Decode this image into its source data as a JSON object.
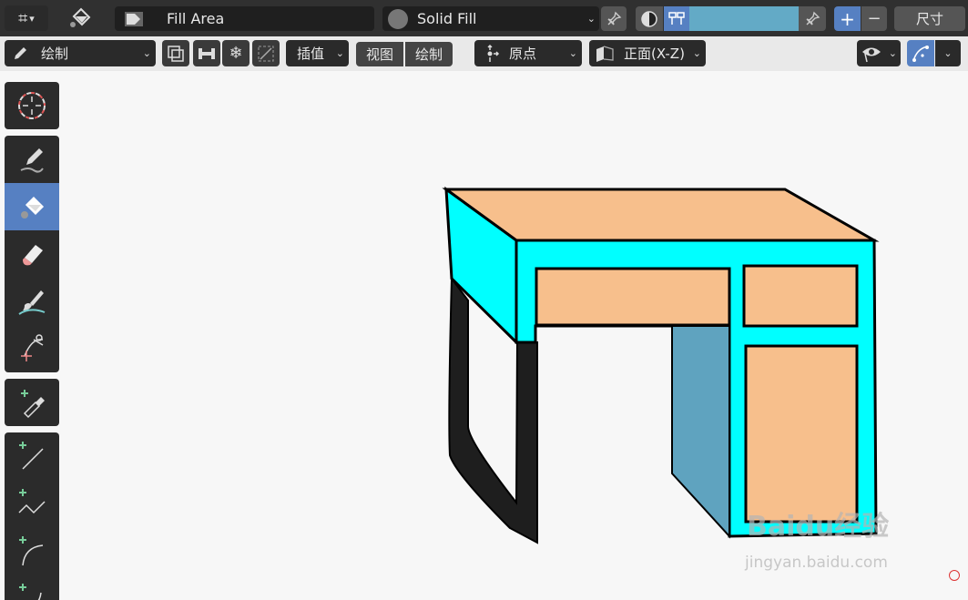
{
  "header": {
    "fill_mode": "Fill Area",
    "fill_type": "Solid Fill",
    "size_label": "尺寸",
    "plus": "+",
    "minus": "−"
  },
  "toolbar2": {
    "mode": "绘制",
    "interpolate": "插值",
    "view": "视图",
    "draw": "绘制",
    "origin": "原点",
    "orientation": "正面(X-Z)"
  },
  "colors": {
    "active_tool": "#5680c2",
    "swatch": "#63aac6",
    "desk_top": "#f7bf8c",
    "desk_front": "#00ffff",
    "desk_side_panel": "#5fa3bf",
    "desk_leg": "#1e1e1e"
  },
  "watermark": {
    "brand": "Baidu经验",
    "url": "jingyan.baidu.com"
  }
}
